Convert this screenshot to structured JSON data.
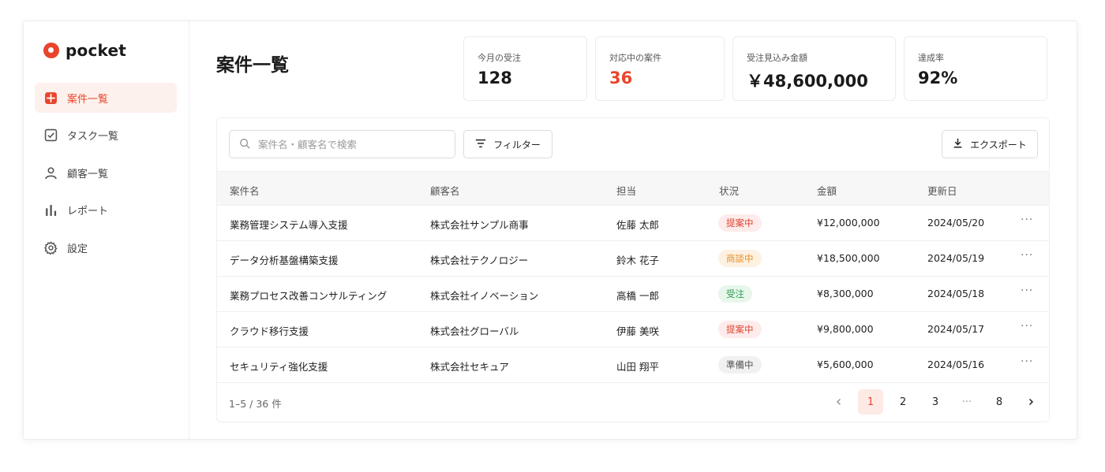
{
  "brand": {
    "name": "pocket",
    "color": "#e8452c"
  },
  "nav": [
    {
      "label": "案件一覧",
      "icon": "case-list-icon",
      "active": true
    },
    {
      "label": "タスク一覧",
      "icon": "task-check-icon",
      "active": false
    },
    {
      "label": "顧客一覧",
      "icon": "person-icon",
      "active": false
    },
    {
      "label": "レポート",
      "icon": "bar-chart-icon",
      "active": false
    },
    {
      "label": "設定",
      "icon": "gear-icon",
      "active": false
    }
  ],
  "page": {
    "title": "案件一覧"
  },
  "stats": [
    {
      "label": "今月の受注",
      "value": "128"
    },
    {
      "label": "対応中の案件",
      "value": "36"
    },
    {
      "label": "受注見込み金額",
      "value": "￥48,600,000"
    },
    {
      "label": "達成率",
      "value": "92%"
    }
  ],
  "toolbar": {
    "search_placeholder": "案件名・顧客名で検索",
    "filter_label": "フィルター",
    "export_label": "エクスポート"
  },
  "table": {
    "columns": [
      "案件名",
      "顧客名",
      "担当",
      "状況",
      "金額",
      "更新日"
    ],
    "rows": [
      {
        "name": "業務管理システム導入支援",
        "client": "株式会社サンプル商事",
        "owner": "佐藤 太郎",
        "status": "提案中",
        "amount": "¥12,000,000",
        "updated": "2024/05/20"
      },
      {
        "name": "データ分析基盤構築支援",
        "client": "株式会社テクノロジー",
        "owner": "鈴木 花子",
        "status": "商談中",
        "amount": "¥18,500,000",
        "updated": "2024/05/19"
      },
      {
        "name": "業務プロセス改善コンサルティング",
        "client": "株式会社イノベーション",
        "owner": "高橋 一郎",
        "status": "受注",
        "amount": "¥8,300,000",
        "updated": "2024/05/18"
      },
      {
        "name": "クラウド移行支援",
        "client": "株式会社グローバル",
        "owner": "伊藤 美咲",
        "status": "提案中",
        "amount": "¥9,800,000",
        "updated": "2024/05/17"
      },
      {
        "name": "セキュリティ強化支援",
        "client": "株式会社セキュア",
        "owner": "山田 翔平",
        "status": "準備中",
        "amount": "¥5,600,000",
        "updated": "2024/05/16"
      }
    ],
    "row_action": "···"
  },
  "status_colors": {
    "提案中": {
      "bg": "#fdeceb",
      "fg": "#e0452f"
    },
    "商談中": {
      "bg": "#fdf1e2",
      "fg": "#e8902a"
    },
    "受注": {
      "bg": "#e8f6ec",
      "fg": "#2f9e52"
    },
    "準備中": {
      "bg": "#f1f1f1",
      "fg": "#555555"
    }
  },
  "pagination": {
    "summary": "1–5 / 36 件",
    "pages": [
      "1",
      "2",
      "3",
      "···",
      "8"
    ],
    "current": "1"
  }
}
